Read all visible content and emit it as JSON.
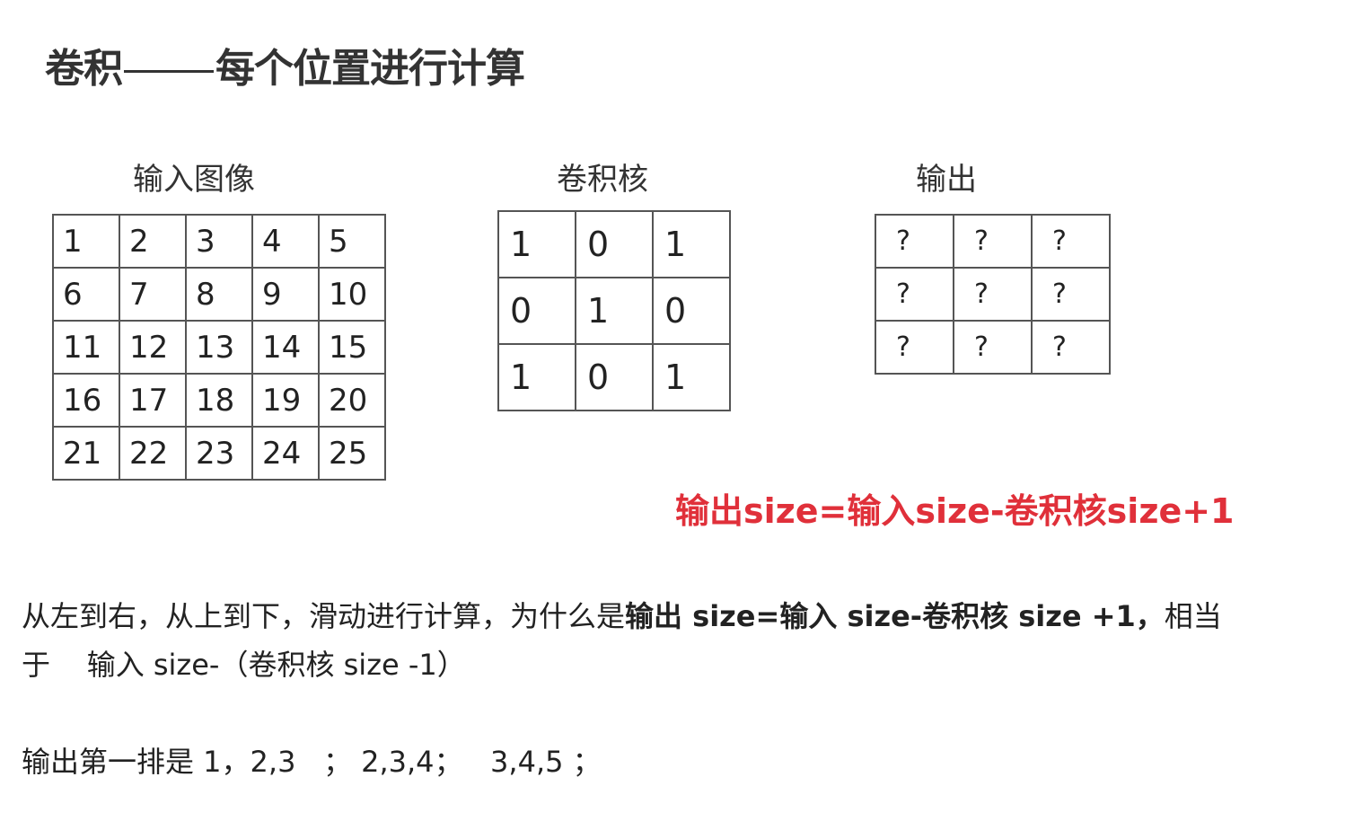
{
  "title": {
    "left": "卷积",
    "right": "每个位置进行计算"
  },
  "input_image": {
    "label": "输入图像",
    "rows": [
      [
        "1",
        "2",
        "3",
        "4",
        "5"
      ],
      [
        "6",
        "7",
        "8",
        "9",
        "10"
      ],
      [
        "11",
        "12",
        "13",
        "14",
        "15"
      ],
      [
        "16",
        "17",
        "18",
        "19",
        "20"
      ],
      [
        "21",
        "22",
        "23",
        "24",
        "25"
      ]
    ]
  },
  "kernel": {
    "label": "卷积核",
    "rows": [
      [
        "1",
        "0",
        "1"
      ],
      [
        "0",
        "1",
        "0"
      ],
      [
        "1",
        "0",
        "1"
      ]
    ]
  },
  "output": {
    "label": "输出",
    "rows": [
      [
        "?",
        "?",
        "?"
      ],
      [
        "?",
        "?",
        "?"
      ],
      [
        "?",
        "?",
        "?"
      ]
    ]
  },
  "formula": "输出size=输入size-卷积核size+1",
  "text": {
    "line1_part1": "从左到右，从上到下，滑动进行计算，为什么是",
    "line1_bold": "输出 size=输入 size-卷积核 size +1，",
    "line1_part2": "相当",
    "line2": "于    输入 size-（卷积核 size -1）",
    "line3": "输出第一排是 1，2,3   ； 2,3,4；   3,4,5 ；"
  },
  "colors": {
    "formula": "#e0303a",
    "grid_border": "#555555"
  }
}
